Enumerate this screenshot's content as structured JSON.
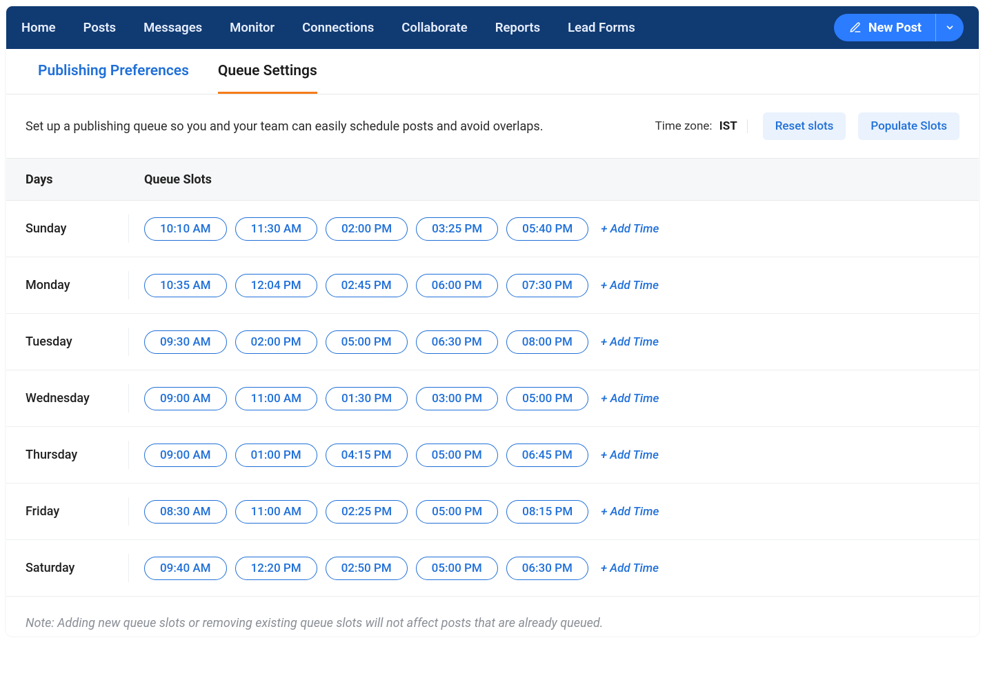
{
  "nav": {
    "items": [
      "Home",
      "Posts",
      "Messages",
      "Monitor",
      "Connections",
      "Collaborate",
      "Reports",
      "Lead Forms"
    ],
    "new_post": "New Post"
  },
  "tabs": {
    "publishing_preferences": "Publishing Preferences",
    "queue_settings": "Queue Settings"
  },
  "description": "Set up a publishing queue so you and your team can easily schedule posts and avoid overlaps.",
  "timezone": {
    "label": "Time zone:",
    "value": "IST"
  },
  "buttons": {
    "reset_slots": "Reset slots",
    "populate_slots": "Populate Slots",
    "add_time": "+ Add Time"
  },
  "table": {
    "header_days": "Days",
    "header_slots": "Queue Slots",
    "rows": [
      {
        "day": "Sunday",
        "slots": [
          "10:10 AM",
          "11:30 AM",
          "02:00 PM",
          "03:25 PM",
          "05:40 PM"
        ]
      },
      {
        "day": "Monday",
        "slots": [
          "10:35 AM",
          "12:04 PM",
          "02:45 PM",
          "06:00 PM",
          "07:30 PM"
        ]
      },
      {
        "day": "Tuesday",
        "slots": [
          "09:30 AM",
          "02:00 PM",
          "05:00 PM",
          "06:30 PM",
          "08:00 PM"
        ]
      },
      {
        "day": "Wednesday",
        "slots": [
          "09:00 AM",
          "11:00 AM",
          "01:30 PM",
          "03:00 PM",
          "05:00 PM"
        ]
      },
      {
        "day": "Thursday",
        "slots": [
          "09:00 AM",
          "01:00 PM",
          "04:15 PM",
          "05:00 PM",
          "06:45 PM"
        ]
      },
      {
        "day": "Friday",
        "slots": [
          "08:30 AM",
          "11:00 AM",
          "02:25 PM",
          "05:00 PM",
          "08:15 PM"
        ]
      },
      {
        "day": "Saturday",
        "slots": [
          "09:40 AM",
          "12:20 PM",
          "02:50 PM",
          "05:00 PM",
          "06:30 PM"
        ]
      }
    ]
  },
  "footnote": "Note: Adding new queue slots or removing existing queue slots will not affect posts that are already queued."
}
